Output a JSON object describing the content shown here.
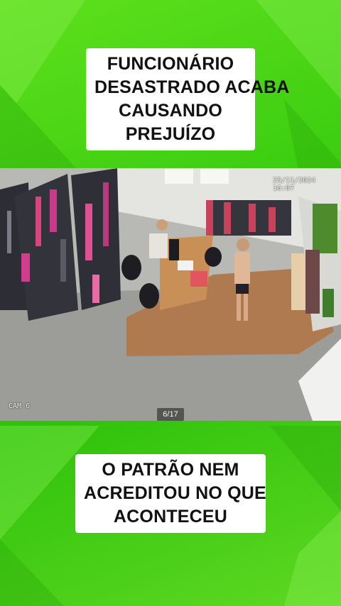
{
  "caption_top": {
    "lines": [
      "FUNCIONÁRIO",
      "DESASTRADO ACABA",
      "CAUSANDO",
      "PREJUÍZO"
    ]
  },
  "caption_bottom": {
    "lines": [
      "O PATRÃO NEM",
      "ACREDITOU NO QUE",
      "ACONTECEU"
    ]
  },
  "video": {
    "camera_label": "CAM 6",
    "timestamp": "25/11/2024 16:07",
    "slide_counter": "6/17"
  },
  "colors": {
    "background_green": "#3fcf12",
    "caption_bg": "#ffffff",
    "caption_text": "#111111"
  }
}
